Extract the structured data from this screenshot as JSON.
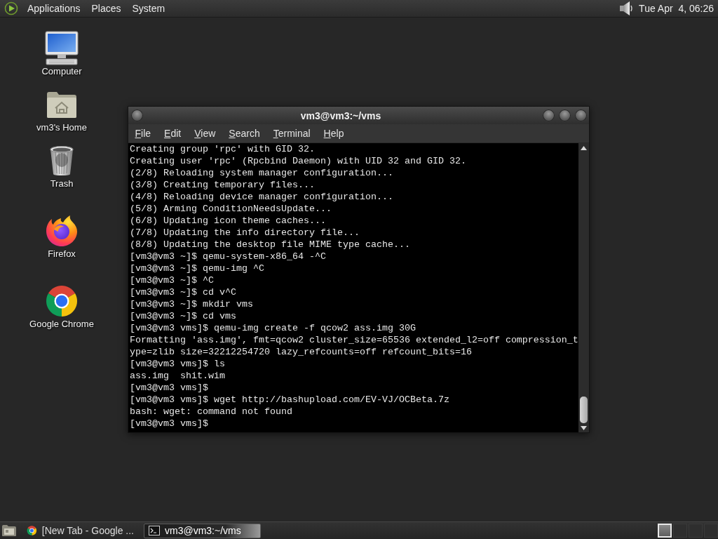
{
  "top_panel": {
    "menus": [
      "Applications",
      "Places",
      "System"
    ],
    "clock": "Tue Apr  4, 06:26"
  },
  "desktop_icons": [
    {
      "kind": "computer",
      "label": "Computer"
    },
    {
      "kind": "home",
      "label": "vm3's Home"
    },
    {
      "kind": "trash",
      "label": "Trash"
    },
    {
      "kind": "firefox",
      "label": "Firefox"
    },
    {
      "kind": "chrome",
      "label": "Google Chrome"
    }
  ],
  "terminal_window": {
    "title": "vm3@vm3:~/vms",
    "menu": [
      "File",
      "Edit",
      "View",
      "Search",
      "Terminal",
      "Help"
    ],
    "lines": [
      "Creating group 'rpc' with GID 32.",
      "Creating user 'rpc' (Rpcbind Daemon) with UID 32 and GID 32.",
      "(2/8) Reloading system manager configuration...",
      "(3/8) Creating temporary files...",
      "(4/8) Reloading device manager configuration...",
      "(5/8) Arming ConditionNeedsUpdate...",
      "(6/8) Updating icon theme caches...",
      "(7/8) Updating the info directory file...",
      "(8/8) Updating the desktop file MIME type cache...",
      "[vm3@vm3 ~]$ qemu-system-x86_64 -^C",
      "[vm3@vm3 ~]$ qemu-img ^C",
      "[vm3@vm3 ~]$ ^C",
      "[vm3@vm3 ~]$ cd v^C",
      "[vm3@vm3 ~]$ mkdir vms",
      "[vm3@vm3 ~]$ cd vms",
      "[vm3@vm3 vms]$ qemu-img create -f qcow2 ass.img 30G",
      "Formatting 'ass.img', fmt=qcow2 cluster_size=65536 extended_l2=off compression_t",
      "ype=zlib size=32212254720 lazy_refcounts=off refcount_bits=16",
      "[vm3@vm3 vms]$ ls",
      "ass.img  shit.wim",
      "[vm3@vm3 vms]$",
      "[vm3@vm3 vms]$ wget http://bashupload.com/EV-VJ/OCBeta.7z",
      "bash: wget: command not found",
      "[vm3@vm3 vms]$"
    ]
  },
  "taskbar": {
    "tasks": [
      {
        "kind": "chrome",
        "label": "[New Tab - Google ...",
        "selected": false
      },
      {
        "kind": "terminal",
        "label": "vm3@vm3:~/vms",
        "selected": true
      }
    ],
    "workspaces": [
      {
        "selected": true
      },
      {
        "selected": false
      },
      {
        "selected": false
      },
      {
        "selected": false
      }
    ]
  }
}
